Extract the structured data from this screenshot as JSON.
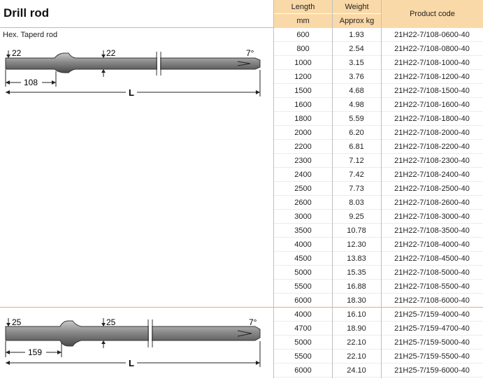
{
  "title": "Drill rod",
  "subtitle": "Hex. Taperd rod",
  "columns": {
    "length": "Length",
    "length_unit": "mm",
    "weight": "Weight",
    "weight_unit": "Approx kg",
    "code": "Product code"
  },
  "drawing1": {
    "hex": "22",
    "shank_len": "108",
    "L": "L",
    "angle": "7°"
  },
  "drawing2": {
    "hex": "25",
    "shank_len": "159",
    "L": "L",
    "angle": "7°"
  },
  "rows": [
    {
      "length": "600",
      "weight": "1.93",
      "code": "21H22-7/108-0600-40"
    },
    {
      "length": "800",
      "weight": "2.54",
      "code": "21H22-7/108-0800-40"
    },
    {
      "length": "1000",
      "weight": "3.15",
      "code": "21H22-7/108-1000-40"
    },
    {
      "length": "1200",
      "weight": "3.76",
      "code": "21H22-7/108-1200-40"
    },
    {
      "length": "1500",
      "weight": "4.68",
      "code": "21H22-7/108-1500-40"
    },
    {
      "length": "1600",
      "weight": "4.98",
      "code": "21H22-7/108-1600-40"
    },
    {
      "length": "1800",
      "weight": "5.59",
      "code": "21H22-7/108-1800-40"
    },
    {
      "length": "2000",
      "weight": "6.20",
      "code": "21H22-7/108-2000-40"
    },
    {
      "length": "2200",
      "weight": "6.81",
      "code": "21H22-7/108-2200-40"
    },
    {
      "length": "2300",
      "weight": "7.12",
      "code": "21H22-7/108-2300-40"
    },
    {
      "length": "2400",
      "weight": "7.42",
      "code": "21H22-7/108-2400-40"
    },
    {
      "length": "2500",
      "weight": "7.73",
      "code": "21H22-7/108-2500-40"
    },
    {
      "length": "2600",
      "weight": "8.03",
      "code": "21H22-7/108-2600-40"
    },
    {
      "length": "3000",
      "weight": "9.25",
      "code": "21H22-7/108-3000-40"
    },
    {
      "length": "3500",
      "weight": "10.78",
      "code": "21H22-7/108-3500-40"
    },
    {
      "length": "4000",
      "weight": "12.30",
      "code": "21H22-7/108-4000-40"
    },
    {
      "length": "4500",
      "weight": "13.83",
      "code": "21H22-7/108-4500-40"
    },
    {
      "length": "5000",
      "weight": "15.35",
      "code": "21H22-7/108-5000-40"
    },
    {
      "length": "5500",
      "weight": "16.88",
      "code": "21H22-7/108-5500-40"
    },
    {
      "length": "6000",
      "weight": "18.30",
      "code": "21H22-7/108-6000-40"
    },
    {
      "length": "4000",
      "weight": "16.10",
      "code": "21H25-7/159-4000-40"
    },
    {
      "length": "4700",
      "weight": "18.90",
      "code": "21H25-7/159-4700-40"
    },
    {
      "length": "5000",
      "weight": "22.10",
      "code": "21H25-7/159-5000-40"
    },
    {
      "length": "5500",
      "weight": "22.10",
      "code": "21H25-7/159-5500-40"
    },
    {
      "length": "6000",
      "weight": "24.10",
      "code": "21H25-7/159-6000-40"
    }
  ]
}
